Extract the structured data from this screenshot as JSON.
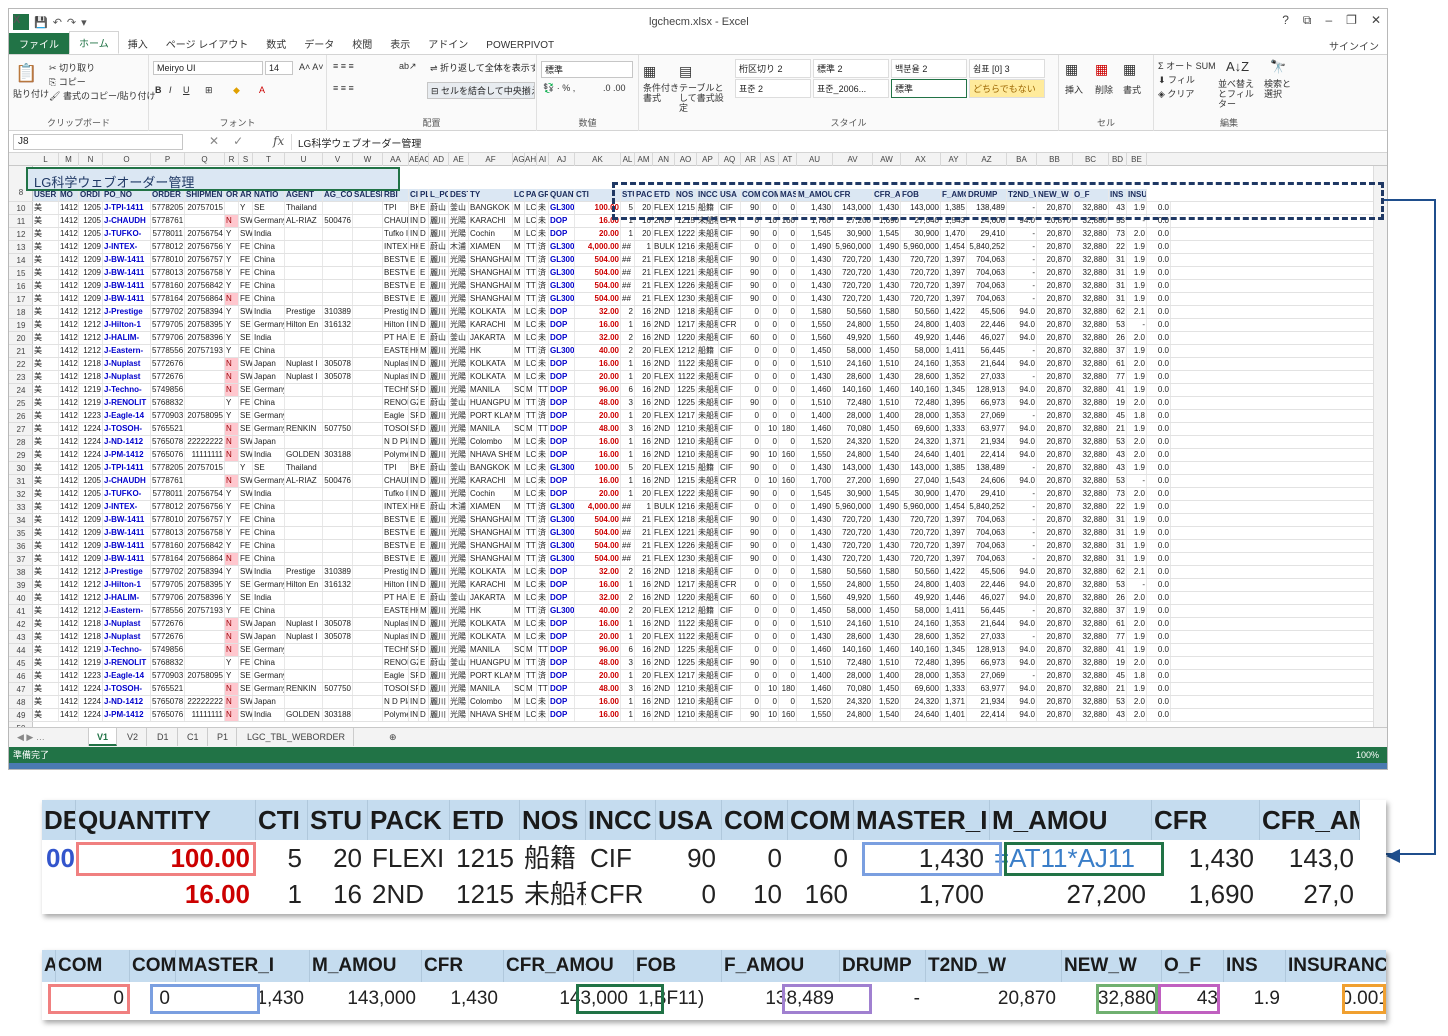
{
  "window": {
    "title": "lgchecm.xlsx - Excel",
    "controls": [
      "?",
      "⧉",
      "–",
      "❐",
      "✕"
    ]
  },
  "qat": {
    "icons": [
      "save-icon",
      "undo-icon",
      "redo-icon",
      "customize-icon"
    ]
  },
  "tabs": [
    "ファイル",
    "ホーム",
    "挿入",
    "ページ レイアウト",
    "数式",
    "データ",
    "校閲",
    "表示",
    "アドイン",
    "POWERPIVOT"
  ],
  "signin": "サインイン",
  "ribbon": {
    "clipboard": {
      "paste": "貼り付け",
      "cut": "切り取り",
      "copy": "コピー",
      "format_painter": "書式のコピー/貼り付け",
      "label": "クリップボード"
    },
    "font": {
      "name": "Meiryo UI",
      "size": "14",
      "label": "フォント"
    },
    "alignment": {
      "wrap": "折り返して全体を表示する",
      "merge": "セルを結合して中央揃え",
      "label": "配置"
    },
    "number": {
      "format": "標準",
      "label": "数値"
    },
    "styles": {
      "conditional": "条件付き書式",
      "table": "テーブルとして書式設定",
      "cells": [
        "桁区切り 2",
        "標準 2",
        "백분율 2",
        "쉼표 [0] 3",
        "표준 2",
        "표준_2006...",
        "標準",
        "どちらでもない"
      ],
      "label": "スタイル"
    },
    "cells": {
      "insert": "挿入",
      "delete": "削除",
      "format": "書式",
      "label": "セル"
    },
    "editing": {
      "autosum": "オート SUM",
      "fill": "フィル",
      "clear": "クリア",
      "sort": "並べ替えとフィルター",
      "find": "検索と選択",
      "label": "編集"
    }
  },
  "formula_bar": {
    "name_box": "J8",
    "fx": "fx",
    "formula": "LG科学ウェブオーダー管理"
  },
  "sheet": {
    "columns": [
      "L",
      "M",
      "N",
      "O",
      "P",
      "Q",
      "R",
      "S",
      "T",
      "U",
      "V",
      "W",
      "AA",
      "AE",
      "AC",
      "AD",
      "AE",
      "AF",
      "AG",
      "AH",
      "AI",
      "AJ",
      "AK",
      "AL",
      "AM",
      "AN",
      "AO",
      "AP",
      "AQ",
      "AR",
      "AS",
      "AT",
      "AU",
      "AV",
      "AW",
      "AX",
      "AY",
      "AZ",
      "BA",
      "BB",
      "BC",
      "BD",
      "BE"
    ],
    "title": "LG科学ウェブオーダー管理",
    "header": [
      "USER",
      "MO",
      "ORDI",
      "PO_NO",
      "ORDER",
      "SHIPMEN",
      "OR",
      "ARI",
      "NATIO",
      "AGENT",
      "AG_CO",
      "SALESI",
      "RBI",
      "CI",
      "PLAI",
      "L_PO",
      "DESTINATI",
      "TY",
      "LC",
      "PA",
      "GRADE",
      "QUANTITY",
      "CTI",
      "STU",
      "PACK",
      "ETD",
      "NOS",
      "INCC",
      "USA",
      "COM",
      "COM",
      "MASTER_I",
      "M_AMOU",
      "CFR",
      "CFR_AMOU",
      "FOB",
      "F_AMOU",
      "DRUMP",
      "T2ND_W",
      "NEW_W",
      "O_F",
      "INS",
      "INSUR"
    ],
    "rows": [
      [
        "美",
        "1412",
        "1205",
        "J-TPI-1411",
        "5778205",
        "20757015",
        "",
        "Y",
        "SE",
        "Thailand",
        "",
        "",
        "TPI",
        "BK",
        "E",
        "蔚山",
        "釜山",
        "BANGKOK",
        "M",
        "LC",
        "未",
        "GL300",
        "100.00",
        "5",
        "20",
        "FLEXI",
        "1215",
        "船籍",
        "CIF",
        "90",
        "0",
        "0",
        "1,430",
        "143,000",
        "1,430",
        "143,000",
        "1,385",
        "138,489",
        "-",
        "20,870",
        "32,880",
        "43",
        "1.9",
        "0.0"
      ],
      [
        "美",
        "1412",
        "1205",
        "J-CHAUDH",
        "5778761",
        "",
        "N",
        "SW",
        "Germany",
        "AL-RIAZ",
        "500476",
        "",
        "CHAUDH",
        "IN",
        "D",
        "麗川",
        "光陽",
        "KARACHI",
        "M",
        "LC",
        "未",
        "DOP",
        "16.00",
        "1",
        "16",
        "2ND",
        "1215",
        "未船積",
        "CFR",
        "0",
        "10",
        "160",
        "1,700",
        "27,200",
        "1,690",
        "27,040",
        "1,543",
        "24,606",
        "94.0",
        "20,870",
        "32,880",
        "53",
        "-",
        "0.0"
      ],
      [
        "美",
        "1412",
        "1205",
        "J-TUFKO-",
        "5778011",
        "20756754",
        "Y",
        "SW",
        "India",
        "",
        "",
        "",
        "Tufko Int",
        "IN",
        "D",
        "麗川",
        "光陽",
        "Cochin",
        "M",
        "LC",
        "未",
        "DOP",
        "20.00",
        "1",
        "20",
        "FLEXI",
        "1222",
        "未船積",
        "CIF",
        "90",
        "0",
        "0",
        "1,545",
        "30,900",
        "1,545",
        "30,900",
        "1,470",
        "29,410",
        "-",
        "20,870",
        "32,880",
        "73",
        "2.0",
        "0.0"
      ],
      [
        "美",
        "1412",
        "1209",
        "J-INTEX-",
        "5778012",
        "20756756",
        "Y",
        "FE",
        "China",
        "",
        "",
        "",
        "INTEX",
        "HK",
        "E",
        "蔚山",
        "木浦",
        "XIAMEN",
        "M",
        "TT",
        "済",
        "GL300",
        "4,000.00",
        "##",
        "1",
        "BULK",
        "1216",
        "未船積",
        "CIF",
        "0",
        "0",
        "0",
        "1,490",
        "5,960,000",
        "1,490",
        "5,960,000",
        "1,454",
        "5,840,252",
        "-",
        "20,870",
        "32,880",
        "22",
        "1.9",
        "0.0"
      ],
      [
        "美",
        "1412",
        "1209",
        "J-BW-1411",
        "5778010",
        "20756757",
        "Y",
        "FE",
        "China",
        "",
        "",
        "",
        "BESTWASH",
        "E",
        "E",
        "麗川",
        "光陽",
        "SHANGHAI",
        "M",
        "TT",
        "済",
        "GL300",
        "504.00",
        "##",
        "21",
        "FLEXI",
        "1218",
        "未船積",
        "CIF",
        "90",
        "0",
        "0",
        "1,430",
        "720,720",
        "1,430",
        "720,720",
        "1,397",
        "704,063",
        "-",
        "20,870",
        "32,880",
        "31",
        "1.9",
        "0.0"
      ],
      [
        "美",
        "1412",
        "1209",
        "J-BW-1411",
        "5778013",
        "20756758",
        "Y",
        "FE",
        "China",
        "",
        "",
        "",
        "BESTWASH",
        "E",
        "E",
        "麗川",
        "光陽",
        "SHANGHAI",
        "M",
        "TT",
        "済",
        "GL300",
        "504.00",
        "##",
        "21",
        "FLEXI",
        "1221",
        "未船積",
        "CIF",
        "90",
        "0",
        "0",
        "1,430",
        "720,720",
        "1,430",
        "720,720",
        "1,397",
        "704,063",
        "-",
        "20,870",
        "32,880",
        "31",
        "1.9",
        "0.0"
      ],
      [
        "美",
        "1412",
        "1209",
        "J-BW-1411",
        "5778160",
        "20756842",
        "Y",
        "FE",
        "China",
        "",
        "",
        "",
        "BESTWASH",
        "E",
        "E",
        "麗川",
        "光陽",
        "SHANGHAI",
        "M",
        "TT",
        "済",
        "GL300",
        "504.00",
        "##",
        "21",
        "FLEXI",
        "1226",
        "未船積",
        "CIF",
        "90",
        "0",
        "0",
        "1,430",
        "720,720",
        "1,430",
        "720,720",
        "1,397",
        "704,063",
        "-",
        "20,870",
        "32,880",
        "31",
        "1.9",
        "0.0"
      ],
      [
        "美",
        "1412",
        "1209",
        "J-BW-1411",
        "5778164",
        "20756864",
        "N",
        "FE",
        "China",
        "",
        "",
        "",
        "BESTWASH",
        "E",
        "E",
        "麗川",
        "光陽",
        "SHANGHAI",
        "M",
        "TT",
        "済",
        "GL300",
        "504.00",
        "##",
        "21",
        "FLEXI",
        "1230",
        "未船積",
        "CIF",
        "90",
        "0",
        "0",
        "1,430",
        "720,720",
        "1,430",
        "720,720",
        "1,397",
        "704,063",
        "-",
        "20,870",
        "32,880",
        "31",
        "1.9",
        "0.0"
      ],
      [
        "美",
        "1412",
        "1212",
        "J-Prestige",
        "5779702",
        "20758394",
        "Y",
        "SW",
        "India",
        "Prestige",
        "310389",
        "",
        "Prestige",
        "IN",
        "D",
        "麗川",
        "光陽",
        "KOLKATA",
        "M",
        "LC",
        "未",
        "DOP",
        "32.00",
        "2",
        "16",
        "2ND",
        "1218",
        "未船積",
        "CIF",
        "0",
        "0",
        "0",
        "1,580",
        "50,560",
        "1,580",
        "50,560",
        "1,422",
        "45,506",
        "94.0",
        "20,870",
        "32,880",
        "62",
        "2.1",
        "0.0"
      ],
      [
        "美",
        "1412",
        "1212",
        "J-Hilton-1",
        "5779705",
        "20758395",
        "Y",
        "SE",
        "Germany",
        "Hilton En",
        "316132",
        "",
        "Hilton En",
        "IN",
        "D",
        "麗川",
        "光陽",
        "KARACHI",
        "M",
        "LC",
        "未",
        "DOP",
        "16.00",
        "1",
        "16",
        "2ND",
        "1217",
        "未船積",
        "CFR",
        "0",
        "0",
        "0",
        "1,550",
        "24,800",
        "1,550",
        "24,800",
        "1,403",
        "22,446",
        "94.0",
        "20,870",
        "32,880",
        "53",
        "-",
        "0.0"
      ],
      [
        "美",
        "1412",
        "1212",
        "J-HALIM-",
        "5779706",
        "20758396",
        "Y",
        "SE",
        "India",
        "",
        "",
        "",
        "PT HALIM",
        "E",
        "E",
        "蔚山",
        "釜山",
        "JAKARTA",
        "M",
        "LC",
        "未",
        "DOP",
        "32.00",
        "2",
        "16",
        "2ND",
        "1220",
        "未船積",
        "CIF",
        "60",
        "0",
        "0",
        "1,560",
        "49,920",
        "1,560",
        "49,920",
        "1,446",
        "46,027",
        "94.0",
        "20,870",
        "32,880",
        "26",
        "2.0",
        "0.0"
      ],
      [
        "美",
        "1412",
        "1212",
        "J-Eastern-",
        "5778556",
        "20757193",
        "Y",
        "FE",
        "China",
        "",
        "",
        "",
        "EASTER",
        "HK",
        "M",
        "麗川",
        "光陽",
        "HK",
        "M",
        "TT",
        "済",
        "GL300",
        "40.00",
        "2",
        "20",
        "FLEXI",
        "1212",
        "船籍",
        "CIF",
        "0",
        "0",
        "0",
        "1,450",
        "58,000",
        "1,450",
        "58,000",
        "1,411",
        "56,445",
        "-",
        "20,870",
        "32,880",
        "37",
        "1.9",
        "0.0"
      ],
      [
        "美",
        "1412",
        "1218",
        "J-Nuplast",
        "5772676",
        "",
        "N",
        "SW",
        "Japan",
        "Nuplast I",
        "305078",
        "",
        "Nuplast",
        "IN",
        "D",
        "麗川",
        "光陽",
        "KOLKATA",
        "M",
        "LC",
        "未",
        "DOP",
        "16.00",
        "1",
        "16",
        "2ND",
        "1122",
        "未船積",
        "CIF",
        "0",
        "0",
        "0",
        "1,510",
        "24,160",
        "1,510",
        "24,160",
        "1,353",
        "21,644",
        "94.0",
        "20,870",
        "32,880",
        "61",
        "2.0",
        "0.0"
      ],
      [
        "美",
        "1412",
        "1218",
        "J-Nuplast",
        "5772676",
        "",
        "N",
        "SW",
        "Japan",
        "Nuplast I",
        "305078",
        "",
        "Nuplast",
        "IN",
        "D",
        "麗川",
        "光陽",
        "KOLKATA",
        "M",
        "LC",
        "未",
        "DOP",
        "20.00",
        "1",
        "20",
        "FLEXI",
        "1122",
        "未船積",
        "CIF",
        "0",
        "0",
        "0",
        "1,430",
        "28,600",
        "1,430",
        "28,600",
        "1,352",
        "27,033",
        "-",
        "20,870",
        "32,880",
        "77",
        "1.9",
        "0.0"
      ],
      [
        "美",
        "1412",
        "1219",
        "J-Techno-",
        "5749856",
        "",
        "N",
        "SE",
        "Germany",
        "",
        "",
        "",
        "TECHNO",
        "SP",
        "D",
        "麗川",
        "光陽",
        "MANILA",
        "SOU",
        "M",
        "TT",
        "DOP",
        "96.00",
        "6",
        "16",
        "2ND",
        "1225",
        "未船積",
        "CIF",
        "0",
        "0",
        "0",
        "1,460",
        "140,160",
        "1,460",
        "140,160",
        "1,345",
        "128,913",
        "94.0",
        "20,870",
        "32,880",
        "41",
        "1.9",
        "0.0"
      ],
      [
        "美",
        "1412",
        "1219",
        "J-RENOLIT",
        "5768832",
        "",
        "Y",
        "FE",
        "China",
        "",
        "",
        "",
        "RENOLIT",
        "GZ",
        "E",
        "蔚山",
        "釜山",
        "HUANGPU",
        "M",
        "TT",
        "済",
        "DOP",
        "48.00",
        "3",
        "16",
        "2ND",
        "1225",
        "未船積",
        "CIF",
        "90",
        "0",
        "0",
        "1,510",
        "72,480",
        "1,510",
        "72,480",
        "1,395",
        "66,973",
        "94.0",
        "20,870",
        "32,880",
        "19",
        "2.0",
        "0.0"
      ],
      [
        "美",
        "1412",
        "1223",
        "J-Eagle-14",
        "5770903",
        "20758095",
        "Y",
        "SE",
        "Germany",
        "",
        "",
        "",
        "Eagle",
        "SP",
        "D",
        "麗川",
        "光陽",
        "PORT KLANG",
        "M",
        "TT",
        "済",
        "DOP",
        "20.00",
        "1",
        "20",
        "FLEXI",
        "1217",
        "未船積",
        "CIF",
        "0",
        "0",
        "0",
        "1,400",
        "28,000",
        "1,400",
        "28,000",
        "1,353",
        "27,069",
        "-",
        "20,870",
        "32,880",
        "45",
        "1.8",
        "0.0"
      ],
      [
        "美",
        "1412",
        "1224",
        "J-TOSOH-",
        "5765521",
        "",
        "N",
        "SE",
        "Germany",
        "RENKIN",
        "507750",
        "",
        "TOSOH",
        "SP",
        "D",
        "麗川",
        "光陽",
        "MANILA",
        "SOU",
        "M",
        "TT",
        "DOP",
        "48.00",
        "3",
        "16",
        "2ND",
        "1210",
        "未船積",
        "CIF",
        "0",
        "10",
        "180",
        "1,460",
        "70,080",
        "1,450",
        "69,600",
        "1,333",
        "63,977",
        "94.0",
        "20,870",
        "32,880",
        "21",
        "1.9",
        "0.0"
      ],
      [
        "美",
        "1412",
        "1224",
        "J-ND-1412",
        "5765078",
        "22222222",
        "N",
        "SW",
        "Japan",
        "",
        "",
        "",
        "N D Plas",
        "IN",
        "D",
        "麗川",
        "光陽",
        "Colombo",
        "M",
        "LC",
        "未",
        "DOP",
        "16.00",
        "1",
        "16",
        "2ND",
        "1210",
        "未船積",
        "CIF",
        "0",
        "0",
        "0",
        "1,520",
        "24,320",
        "1,520",
        "24,320",
        "1,371",
        "21,934",
        "94.0",
        "20,870",
        "32,880",
        "53",
        "2.0",
        "0.0"
      ],
      [
        "美",
        "1412",
        "1224",
        "J-PM-1412",
        "5765076",
        "11111111",
        "N",
        "SW",
        "India",
        "GOLDEN",
        "303188",
        "",
        "Polymer",
        "IN",
        "D",
        "麗川",
        "光陽",
        "NHAVA SHEN",
        "M",
        "LC",
        "未",
        "DOP",
        "16.00",
        "1",
        "16",
        "2ND",
        "1210",
        "未船積",
        "CIF",
        "90",
        "10",
        "160",
        "1,550",
        "24,800",
        "1,540",
        "24,640",
        "1,401",
        "22,414",
        "94.0",
        "20,870",
        "32,880",
        "43",
        "2.0",
        "0.0"
      ]
    ],
    "row_numbers": [
      "8",
      "10",
      "11",
      "12",
      "13",
      "14",
      "15",
      "16",
      "17",
      "18",
      "19",
      "20",
      "21",
      "22",
      "23",
      "24",
      "25",
      "26",
      "27",
      "28",
      "29",
      "30",
      "31",
      "32",
      "33",
      "34",
      "35",
      "36",
      "37",
      "38",
      "39",
      "40",
      "41",
      "42",
      "43",
      "44",
      "45",
      "46",
      "47",
      "48",
      "49",
      "50"
    ]
  },
  "sheet_tabs": [
    "V1",
    "V2",
    "D1",
    "C1",
    "P1",
    "LGC_TBL_WEBORDER"
  ],
  "status": {
    "ready": "準備完了",
    "zoom": "100%"
  },
  "zoom1": {
    "headers": [
      "DE",
      "QUANTITY",
      "CTI",
      "STU",
      "PACK",
      "ETD",
      "NOS",
      "INCC",
      "USA",
      "COM",
      "COM",
      "MASTER_I",
      "M_AMOU",
      "CFR",
      "CFR_AM"
    ],
    "row1": [
      "00",
      "100.00",
      "5",
      "20",
      "FLEXI",
      "1215",
      "船籍",
      "CIF",
      "90",
      "0",
      "0",
      "1,430",
      "=AT11*AJ11",
      "1,430",
      "143,0"
    ],
    "row2": [
      "",
      "16.00",
      "1",
      "16",
      "2ND",
      "1215",
      "未船積",
      "CFR",
      "0",
      "10",
      "160",
      "1,700",
      "27,200",
      "1,690",
      "27,0"
    ]
  },
  "zoom2": {
    "headers": [
      "A",
      "COM",
      "COM",
      "MASTER_I",
      "M_AMOU",
      "CFR",
      "CFR_AMOU",
      "FOB",
      "F_AMOU",
      "DRUMP",
      "T2ND_W",
      "NEW_W",
      "O_F",
      "INS",
      "INSURANC",
      "INT"
    ],
    "row": [
      "",
      "0",
      "0",
      "1,430",
      "143,000",
      "1,430",
      "143,000",
      "1,BF11)",
      "138,489",
      "-",
      "20,870",
      "32,880",
      "43",
      "1.9",
      "0.00130",
      ""
    ]
  },
  "colors": {
    "accent": "#217346",
    "dash": "#1f3864",
    "header_fill": "#dbe7f3"
  }
}
